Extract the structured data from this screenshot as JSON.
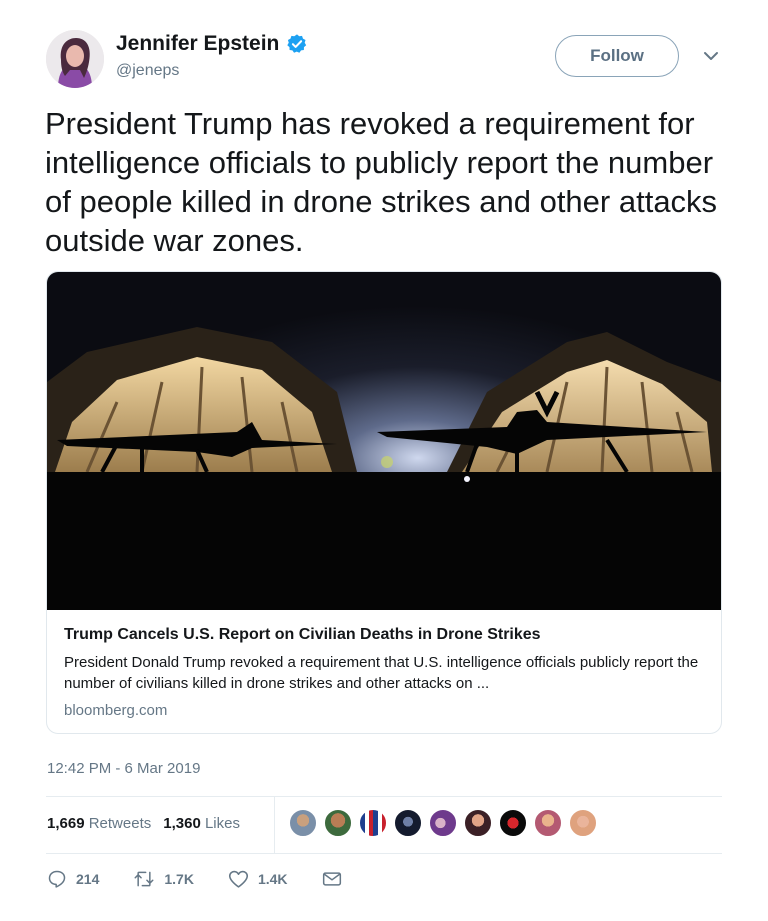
{
  "author": {
    "name": "Jennifer Epstein",
    "handle": "@jeneps",
    "verified": true
  },
  "follow_label": "Follow",
  "tweet_text": "President Trump has revoked a requirement for intelligence officials to publicly report the number of people killed in drone strikes and other attacks outside war zones.",
  "card": {
    "title": "Trump Cancels U.S. Report on Civilian Deaths in Drone Strikes",
    "description": "President Donald Trump revoked a requirement that U.S. intelligence officials publicly report the number of civilians killed in drone strikes and other attacks on ...",
    "domain": "bloomberg.com"
  },
  "timestamp": "12:42 PM - 6 Mar 2019",
  "stats": {
    "retweets_count": "1,669",
    "retweets_label": "Retweets",
    "likes_count": "1,360",
    "likes_label": "Likes"
  },
  "actions": {
    "replies": "214",
    "retweets": "1.7K",
    "likes": "1.4K"
  },
  "colors": {
    "verified_badge": "#1da1f2",
    "secondary_text": "#657786",
    "border": "#e1e8ed"
  },
  "icons": [
    "verified-badge-icon",
    "chevron-down-icon",
    "reply-icon",
    "retweet-icon",
    "like-icon",
    "direct-message-icon"
  ]
}
